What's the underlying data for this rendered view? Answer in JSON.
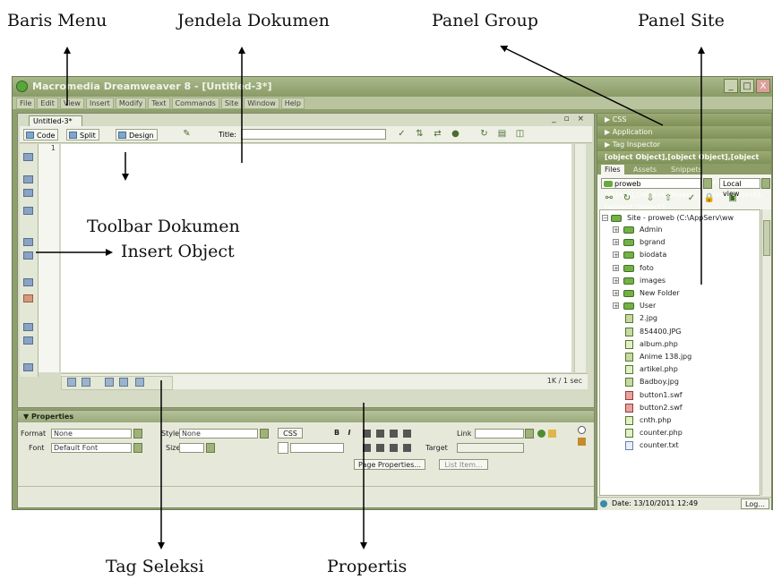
{
  "callouts": {
    "baris_menu": "Baris Menu",
    "jendela_dokumen": "Jendela Dokumen",
    "panel_group": "Panel Group",
    "panel_site": "Panel Site",
    "toolbar_dokumen": "Toolbar Dokumen",
    "insert_object": "Insert Object",
    "tag_seleksi": "Tag Seleksi",
    "propertis": "Propertis"
  },
  "window": {
    "title": "Macromedia Dreamweaver 8 - [Untitled-3*]",
    "controls": [
      "_",
      "□",
      "X"
    ]
  },
  "menu": [
    "File",
    "Edit",
    "View",
    "Insert",
    "Modify",
    "Text",
    "Commands",
    "Site",
    "Window",
    "Help"
  ],
  "document": {
    "tab": "Untitled-3*",
    "tab_controls": "_ ▫ ×",
    "views": {
      "code": "Code",
      "split": "Split",
      "design": "Design"
    },
    "title_label": "Title:",
    "title_value": "",
    "line_number": "1",
    "status": "1K / 1 sec"
  },
  "properties": {
    "header": "▼ Properties",
    "format_label": "Format",
    "format_value": "None",
    "style_label": "Style",
    "style_value": "None",
    "css_button": "CSS",
    "bold": "B",
    "italic": "I",
    "link_label": "Link",
    "font_label": "Font",
    "font_value": "Default Font",
    "size_label": "Size",
    "size_value": "",
    "target_label": "Target",
    "page_properties": "Page Properties...",
    "list_item": "List Item..."
  },
  "panels": {
    "css": "▶ CSS",
    "application": "▶ Application",
    "tag_inspector": "▶ Tag Inspector",
    "files": [
      {
        "name": "2.jpg",
        "type": "img"
      },
      {
        "name": "854400.JPG",
        "type": "img"
      },
      {
        "name": "album.php",
        "type": "php"
      },
      {
        "name": "Anime 138.jpg",
        "type": "img"
      },
      {
        "name": "artikel.php",
        "type": "php"
      },
      {
        "name": "Badboy.jpg",
        "type": "img"
      },
      {
        "name": "button1.swf",
        "type": "swf"
      },
      {
        "name": "button2.swf",
        "type": "swf"
      },
      {
        "name": "cnth.php",
        "type": "php"
      },
      {
        "name": "counter.php",
        "type": "php"
      },
      {
        "name": "counter.txt",
        "type": "txt"
      }
    ],
    "tabs": [
      "Files",
      "Assets",
      "Snippets"
    ],
    "site_select": "proweb",
    "view_select": "Local view",
    "tree_root": "Site - proweb (C:\\AppServ\\ww",
    "folders": [
      "Admin",
      "bgrand",
      "biodata",
      "foto",
      "images",
      "New Folder",
      "User"
    ],
    "status": "Date: 13/10/2011 12:49",
    "log_button": "Log..."
  }
}
